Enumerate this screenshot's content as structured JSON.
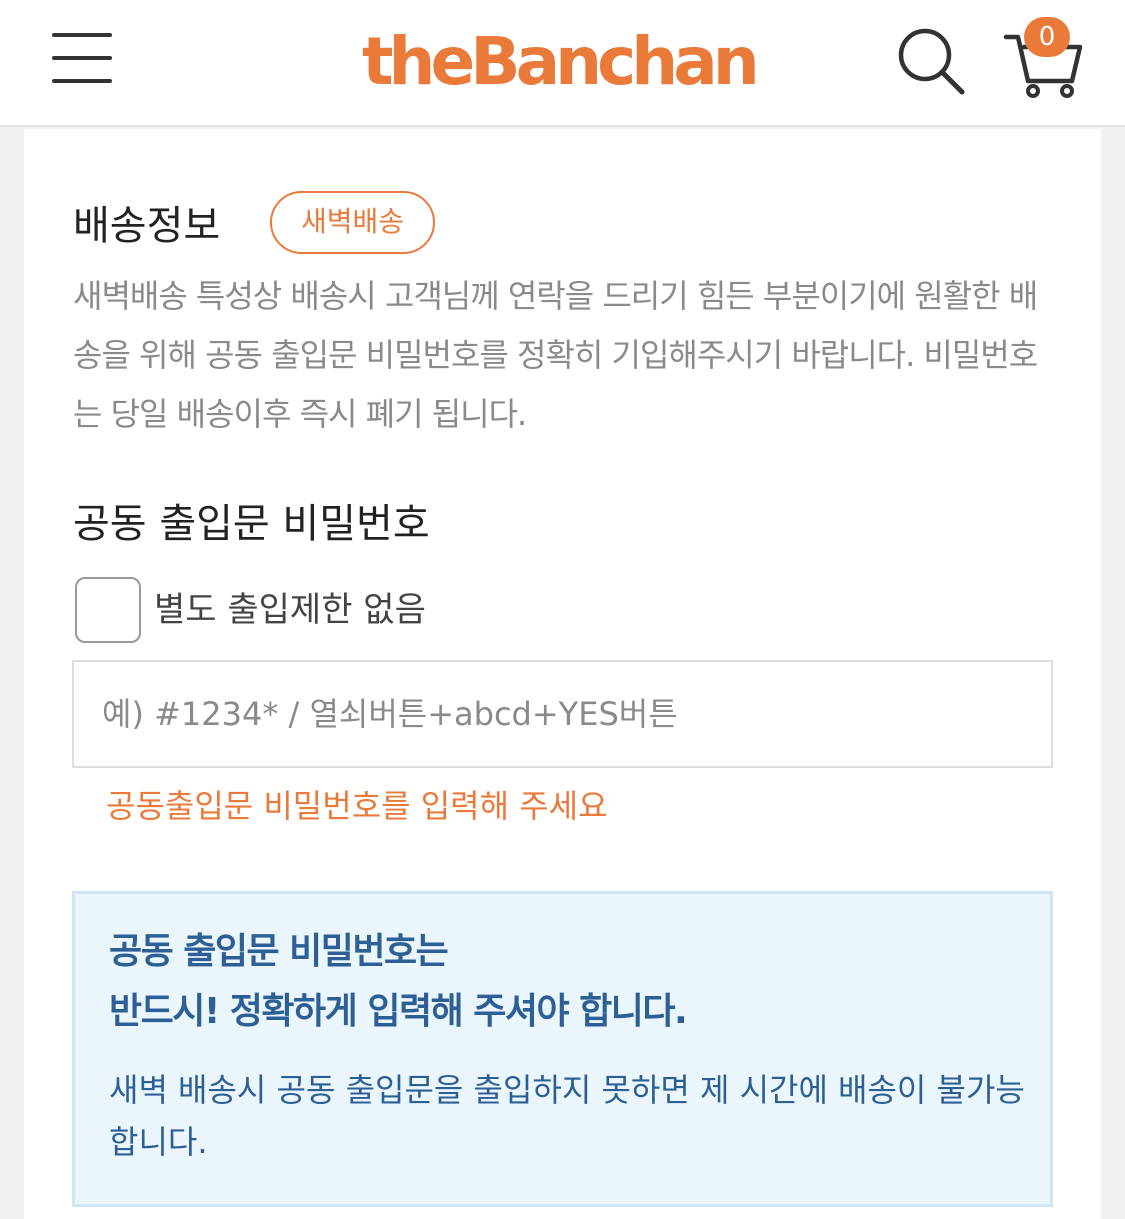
{
  "header": {
    "logo": "theBanchan",
    "cart_count": "0",
    "icons": [
      "menu-icon",
      "search-icon",
      "cart-icon"
    ]
  },
  "delivery": {
    "title": "배송정보",
    "badge": "새벽배송",
    "notice": "새벽배송 특성상 배송시 고객님께 연락을 드리기 힘든 부분이기에 원활한 배송을 위해 공동 출입문 비밀번호를 정확히 기입해주시기 바랍니다. 비밀번호는 당일 배송이후 즉시 폐기 됩니다."
  },
  "password_field": {
    "title": "공동 출입문 비밀번호",
    "checkbox_label": "별도 출입제한 없음",
    "checkbox_checked": false,
    "value": "",
    "placeholder": "예) #1234* / 열쇠버튼+abcd+YES버튼",
    "error": "공동출입문 비밀번호를 입력해 주세요"
  },
  "info_box": {
    "heading_line1": "공동 출입문 비밀번호는",
    "heading_line2": "반드시! 정확하게 입력해 주셔야 합니다.",
    "body": "새벽 배송시 공동 출입문을 출입하지 못하면 제 시간에 배송이 불가능합니다."
  },
  "colors": {
    "accent": "#ea7a3a",
    "info_text": "#2d5f96",
    "info_bg": "#eaf6fc"
  }
}
